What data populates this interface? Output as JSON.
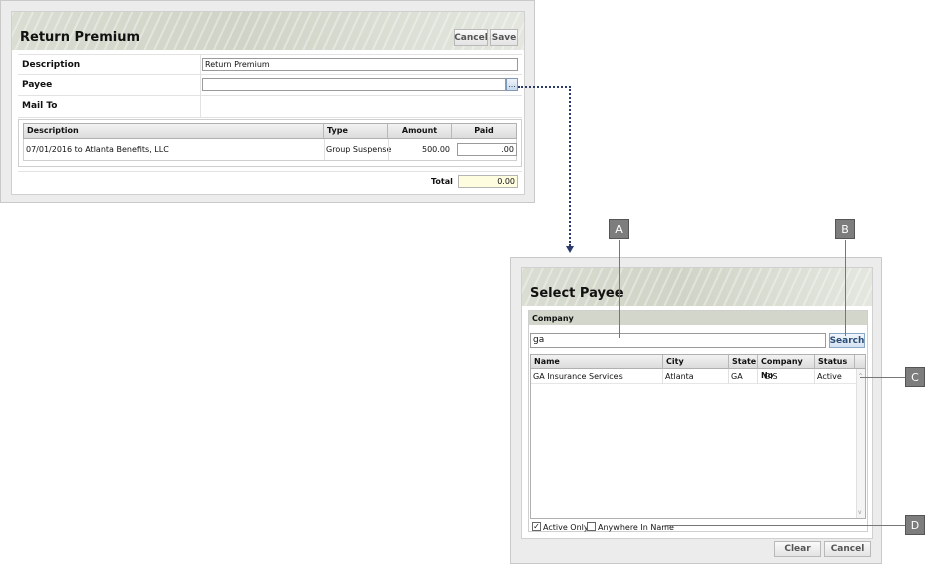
{
  "return_premium": {
    "title": "Return Premium",
    "cancel_label": "Cancel",
    "save_label": "Save",
    "description_label": "Description",
    "description_value": "Return Premium",
    "payee_label": "Payee",
    "payee_value": "",
    "lookup_glyph": "...",
    "mail_to_label": "Mail To",
    "grid": {
      "headers": [
        "Description",
        "Type",
        "Amount",
        "Paid"
      ],
      "rows": [
        {
          "description": "07/01/2016 to Atlanta Benefits, LLC",
          "type": "Group Suspense",
          "amount": "500.00",
          "paid": ".00"
        }
      ]
    },
    "total_label": "Total",
    "total_value": "0.00"
  },
  "select_payee": {
    "title": "Select Payee",
    "section_label": "Company",
    "search_value": "ga",
    "search_label": "Search",
    "grid": {
      "headers": [
        "Name",
        "City",
        "State",
        "Company No",
        "Status"
      ],
      "rows": [
        {
          "name": "GA Insurance Services",
          "city": "Atlanta",
          "state": "GA",
          "company_no": "GIS",
          "status": "Active"
        }
      ]
    },
    "active_only_label": "Active Only",
    "active_only_checked": true,
    "anywhere_label": "Anywhere In Name",
    "anywhere_checked": false,
    "clear_label": "Clear",
    "cancel_label": "Cancel"
  },
  "callouts": {
    "a": "A",
    "b": "B",
    "c": "C",
    "d": "D"
  },
  "colors": {
    "header_bg": "#d3d7cb",
    "total_bg": "#fffde0",
    "callout_bg": "#7d7d7d",
    "connector": "#2b3a6b"
  }
}
